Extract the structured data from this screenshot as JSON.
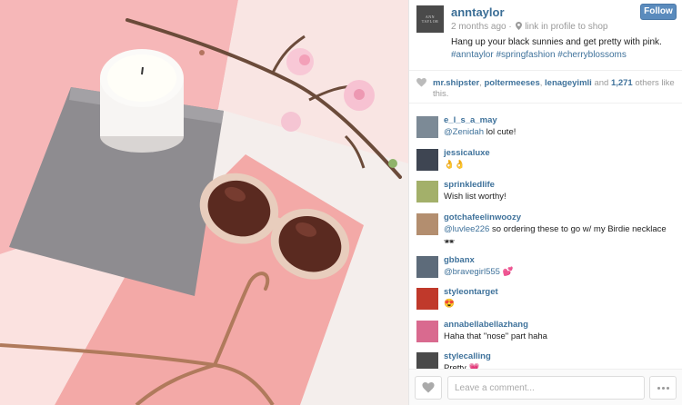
{
  "post": {
    "brand_mark": "ANN TAYLOR",
    "username": "anntaylor",
    "time": "2 months ago",
    "location": "link in profile to shop",
    "caption": "Hang up your black sunnies and get pretty with pink.",
    "hashtags": "#anntaylor #springfashion #cherryblossoms",
    "follow_label": "Follow"
  },
  "likes": {
    "user1": "mr.shipster",
    "user2": "poltermeeses",
    "user3": "lenageyimli",
    "and_text": "and",
    "count": "1,271",
    "others_text": "others like this."
  },
  "comments": [
    {
      "user": "e_l_s_a_may",
      "mention": "@Zenidah",
      "text": " lol cute!",
      "avatar_color": "#7c8a96"
    },
    {
      "user": "jessicaluxe",
      "mention": "",
      "text": "👌👌",
      "avatar_color": "#3e4552"
    },
    {
      "user": "sprinkledlife",
      "mention": "",
      "text": "Wish list worthy!",
      "avatar_color": "#a3b06a"
    },
    {
      "user": "gotchafeelinwoozy",
      "mention": "@luvlee226",
      "text": " so ordering these to go w/ my Birdie necklace 🕶",
      "avatar_color": "#b38e6f"
    },
    {
      "user": "gbbanx",
      "mention": "@bravegirl555",
      "text": " 💕",
      "avatar_color": "#5d6b7a"
    },
    {
      "user": "styleontarget",
      "mention": "",
      "text": "😍",
      "avatar_color": "#c0392b"
    },
    {
      "user": "annabellabellazhang",
      "mention": "",
      "text": "Haha that \"nose\" part haha",
      "avatar_color": "#d96a8f"
    },
    {
      "user": "stylecalling",
      "mention": "",
      "text": "Pretty 💗",
      "avatar_color": "#4a4a4a"
    }
  ],
  "footer": {
    "placeholder": "Leave a comment..."
  },
  "colors": {
    "link": "#3f729b",
    "follow_button": "#5a8bbd"
  }
}
